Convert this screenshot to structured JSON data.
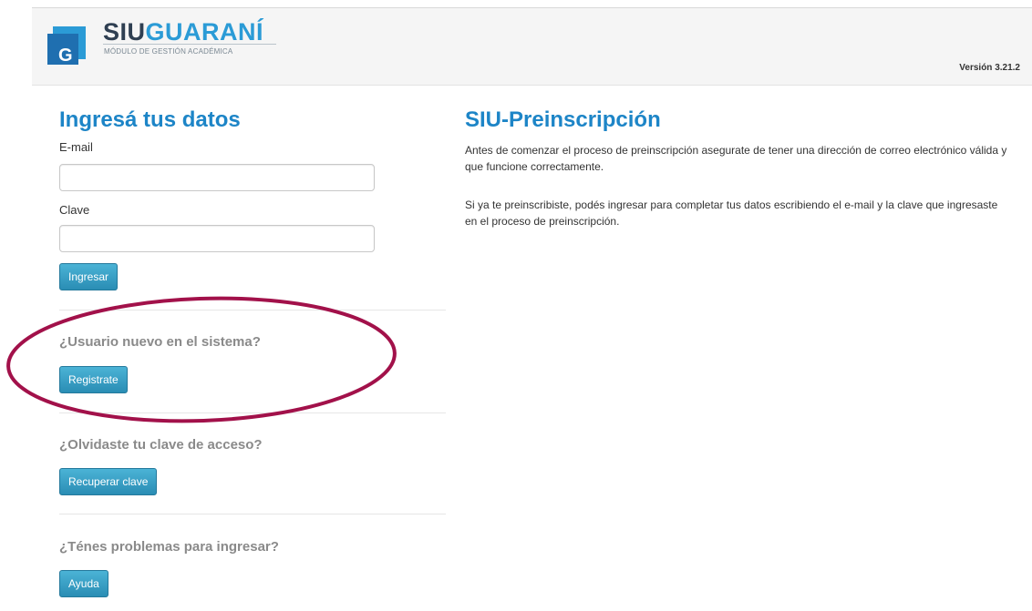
{
  "header": {
    "logo_part1": "SIU",
    "logo_part2": "GUARANÍ",
    "logo_tagline": "MÓDULO DE GESTIÓN ACADÉMICA",
    "logo_letter": "G",
    "version": "Versión 3.21.2"
  },
  "login": {
    "title": "Ingresá tus datos",
    "email_label": "E-mail",
    "email_value": "",
    "password_label": "Clave",
    "password_value": "",
    "submit_label": "Ingresar"
  },
  "register": {
    "question": "¿Usuario nuevo en el sistema?",
    "button_label": "Registrate"
  },
  "recover": {
    "question": "¿Olvidaste tu clave de acceso?",
    "button_label": "Recuperar clave"
  },
  "help": {
    "question": "¿Ténes problemas para ingresar?",
    "button_label": "Ayuda"
  },
  "info": {
    "title": "SIU-Preinscripción",
    "paragraph1": "Antes de comenzar el proceso de preinscripción asegurate de tener una dirección de correo electrónico válida y que funcione correctamente.",
    "paragraph2": "Si ya te preinscribiste, podés ingresar para completar tus datos escribiendo el e-mail y la clave que ingresaste en el proceso de preinscripción."
  },
  "colors": {
    "accent": "#1d85c7",
    "button": "#2a8db4",
    "annotation": "#a2114a"
  },
  "icons": {
    "logo": "siu-guarani-logo-icon"
  }
}
